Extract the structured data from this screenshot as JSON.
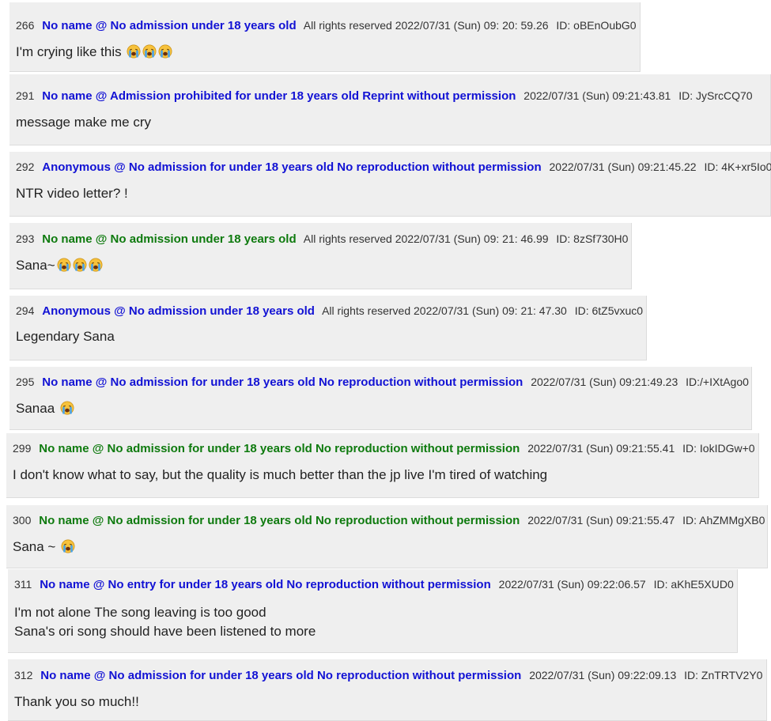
{
  "posts": [
    {
      "number": "266",
      "name": "No name @ No admission under 18 years old",
      "name_color": "#1212d4",
      "meta": "All rights reserved 2022/07/31 (Sun) 09: 20: 59.26",
      "id": "ID: oBEnOubG0",
      "body": [
        "I'm crying like this"
      ],
      "emoji_count": 3,
      "emoji_icon": "loudly-crying-face-icon"
    },
    {
      "number": "291",
      "name": "No name @ Admission prohibited for under 18 years old Reprint without permission",
      "name_color": "#1212d4",
      "meta": "2022/07/31 (Sun) 09:21:43.81",
      "id": "ID: JySrcCQ70",
      "body": [
        "message make me cry"
      ],
      "emoji_count": 0
    },
    {
      "number": "292",
      "name": "Anonymous @ No admission for under 18 years old No reproduction without permission",
      "name_color": "#1212d4",
      "meta": "2022/07/31 (Sun) 09:21:45.22",
      "id": "ID: 4K+xr5Io0",
      "body": [
        "NTR video letter? !"
      ],
      "emoji_count": 0
    },
    {
      "number": "293",
      "name": "No name @ No admission under 18 years old",
      "name_color": "#0e7a0e",
      "meta": "All rights reserved 2022/07/31 (Sun) 09: 21: 46.99",
      "id": "ID: 8zSf730H0",
      "body": [
        "Sana~"
      ],
      "emoji_count": 3,
      "emoji_icon": "loudly-crying-face-icon"
    },
    {
      "number": "294",
      "name": "Anonymous @ No admission under 18 years old",
      "name_color": "#1212d4",
      "meta": "All rights reserved 2022/07/31 (Sun) 09: 21: 47.30",
      "id": "ID: 6tZ5vxuc0",
      "body": [
        "Legendary Sana"
      ],
      "emoji_count": 0
    },
    {
      "number": "295",
      "name": "No name @ No admission for under 18 years old No reproduction without permission",
      "name_color": "#1212d4",
      "meta": "2022/07/31 (Sun) 09:21:49.23",
      "id": "ID:/+IXtAgo0",
      "body": [
        "Sanaa"
      ],
      "emoji_count": 1,
      "emoji_icon": "loudly-crying-face-icon"
    },
    {
      "number": "299",
      "name": "No name @ No admission for under 18 years old No reproduction without permission",
      "name_color": "#0e7a0e",
      "meta": "2022/07/31 (Sun) 09:21:55.41",
      "id": "ID: IokIDGw+0",
      "body": [
        "I don't know what to say, but the quality is much better than the jp live I'm tired of watching"
      ],
      "emoji_count": 0
    },
    {
      "number": "300",
      "name": "No name @ No admission for under 18 years old No reproduction without permission",
      "name_color": "#0e7a0e",
      "meta": "2022/07/31 (Sun) 09:21:55.47",
      "id": "ID: AhZMMgXB0",
      "body": [
        "Sana ~"
      ],
      "emoji_count": 1,
      "emoji_icon": "loudly-crying-face-icon"
    },
    {
      "number": "311",
      "name": "No name @ No entry for under 18 years old No reproduction without permission",
      "name_color": "#1212d4",
      "meta": "2022/07/31 (Sun) 09:22:06.57",
      "id": "ID: aKhE5XUD0",
      "body": [
        "I'm not alone The song leaving is too good",
        "Sana's ori song should have been listened to more"
      ],
      "emoji_count": 0
    },
    {
      "number": "312",
      "name": "No name @ No admission for under 18 years old No reproduction without permission",
      "name_color": "#1212d4",
      "meta": "2022/07/31 (Sun) 09:22:09.13",
      "id": "ID: ZnTRTV2Y0",
      "body": [
        "Thank you so much!!"
      ],
      "emoji_count": 0
    }
  ]
}
